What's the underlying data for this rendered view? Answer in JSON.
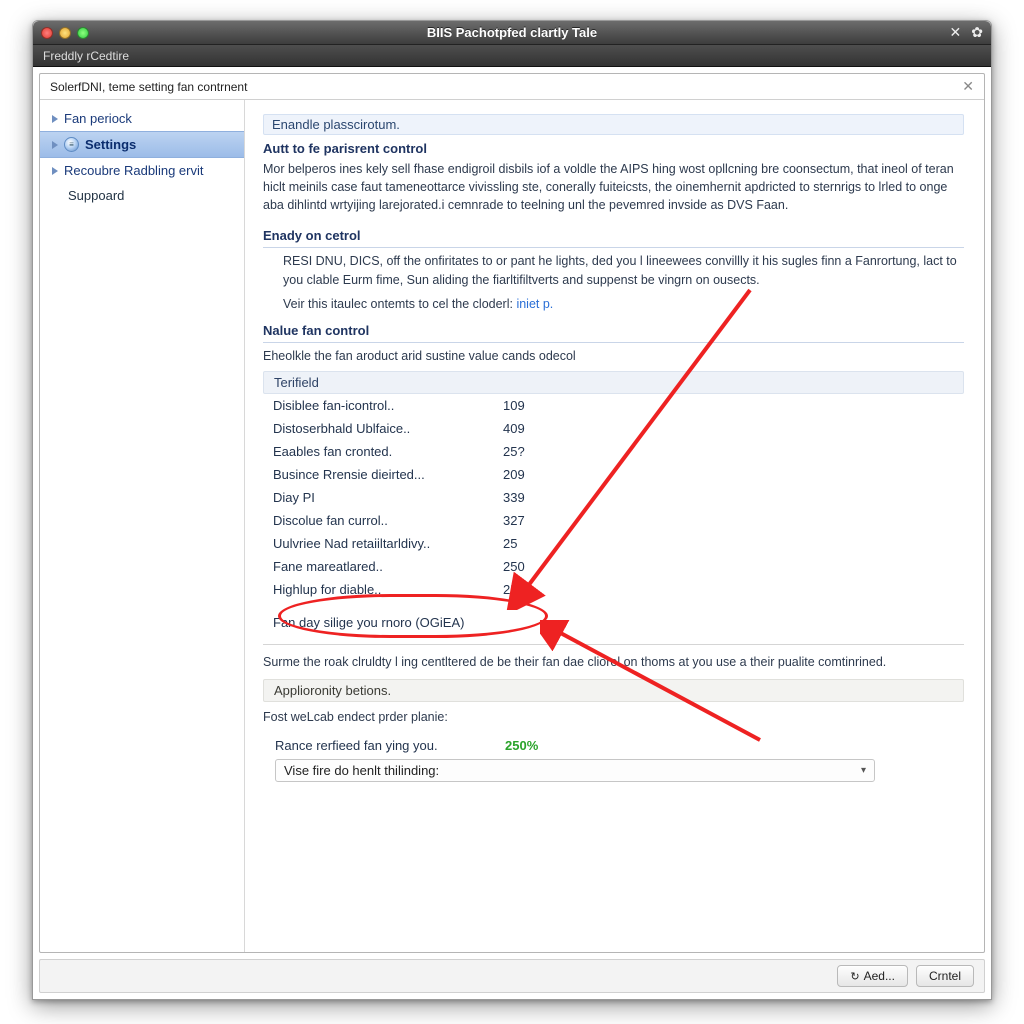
{
  "titlebar": {
    "title": "BIIS Pachotpfed clartly Tale"
  },
  "subtitlebar": {
    "text": "Freddly rCedtire"
  },
  "inner_header": {
    "text": "SolerfDNI, teme setting fan contrnent"
  },
  "sidebar": {
    "items": [
      {
        "label": "Fan periock"
      },
      {
        "label": "Settings"
      },
      {
        "label": "Recoubre Radbling ervit"
      },
      {
        "label": "Suppoard"
      }
    ]
  },
  "content": {
    "band": "Enandle plasscirotum.",
    "h_autto": "Autt to fe parisrent control",
    "p1": "Mor belperos ines kely sell fhase endigroil disbils iof a voldle the AIPS hing wost opllcning bre coonsectum, that ineol of teran hiclt meinils case faut tameneottarce vivissling ste, conerally fuiteicsts, the oinemhernit apdricted to sternrigs to lrled to onge aba dihlintd wrtyijing larejorated.i cemnrade to teelning unl the pevemred invside as DVS Faan.",
    "h_enady": "Enady on cetrol",
    "p2": "RESI DNU, DICS, off the onfiritates to or pant he lights, ded you l lineewees convillly it his sugles finn a Fanrortung, lact to you clable Eurm fime, Sun aliding the fiarltifiltverts and suppenst be vingrn on ousects.",
    "p3a": "Veir this itaulec ontemts to cel the cloderl: ",
    "p3b": "iniet p.",
    "h_nalue": "Nalue fan control",
    "p4": "Eheolkle the fan aroduct arid sustine value cands odecol",
    "table": {
      "head": "Terifield",
      "rows": [
        {
          "label": "Disiblee fan-icontrol..",
          "value": "109"
        },
        {
          "label": "Distoserbhald Ublfaice..",
          "value": "409"
        },
        {
          "label": "Eaables fan cronted.",
          "value": "25?"
        },
        {
          "label": "Busince Rrensie dieirted...",
          "value": "209"
        },
        {
          "label": "Diay PI",
          "value": "339"
        },
        {
          "label": "Discolue fan currol..",
          "value": "327"
        },
        {
          "label": "Uulvriee Nad retaiiltarldivy..",
          "value": "25"
        },
        {
          "label": "Fane mareatlared..",
          "value": "250"
        },
        {
          "label": "Highlup for diable..",
          "value": "25"
        }
      ],
      "note": "Fan day silige you rnoro (OGiEA)"
    },
    "p5": "Surme the roak clruldty l ing centltered de be their fan dae cliorel on thoms at you use a their pualite comtinrined.",
    "sect_head": "Applioronity betions.",
    "p6": "Fost weLcab endect prder planie:",
    "row_rance": {
      "label": "Rance rerfieed fan ying you.",
      "value": "250%"
    },
    "dropdown": {
      "label": "Vise fire do henlt thilinding:"
    }
  },
  "buttons": {
    "aed": "Aed...",
    "crtel": "Crntel"
  },
  "colors": {
    "annotation": "#e22222"
  }
}
